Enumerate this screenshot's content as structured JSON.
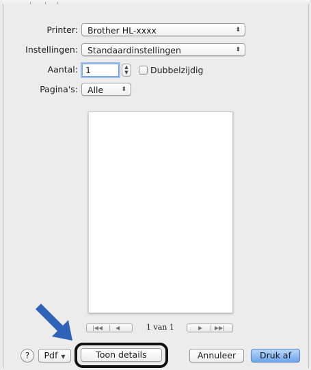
{
  "printer": {
    "label": "Printer:",
    "value": "Brother HL-xxxx"
  },
  "settings": {
    "label": "Instellingen:",
    "value": "Standaardinstellingen"
  },
  "copies": {
    "label": "Aantal:",
    "value": "1",
    "duplex_label": "Dubbelzijdig",
    "duplex_checked": false
  },
  "pages": {
    "label": "Pagina's:",
    "value": "Alle"
  },
  "preview": {
    "page_indicator": "1 van 1"
  },
  "footer": {
    "help_label": "?",
    "pdf_label": "Pdf",
    "details_label": "Toon details",
    "cancel_label": "Annuleer",
    "print_label": "Druk af"
  },
  "colors": {
    "highlight_ring": "#111111",
    "annotation_arrow": "#2f63b7",
    "default_button": "#6da6ec"
  },
  "icons": {
    "popup": "up-down-arrows-icon",
    "stepper": "stepper-icon",
    "nav": [
      "first-page-icon",
      "prev-page-icon",
      "next-page-icon",
      "last-page-icon"
    ],
    "annotation": "arrow-pointer-icon"
  }
}
